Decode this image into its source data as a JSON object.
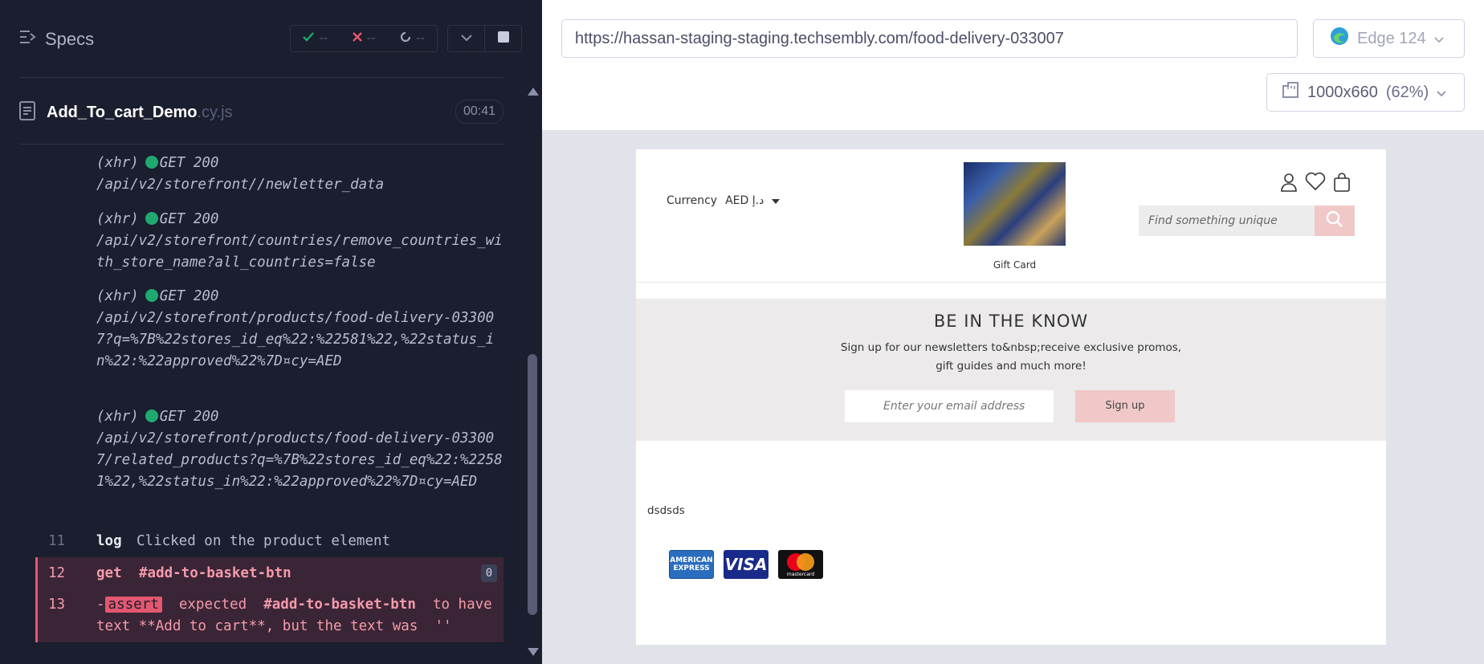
{
  "reporter": {
    "specs_label": "Specs",
    "stats": {
      "passed": "--",
      "failed": "--",
      "pending": "--"
    },
    "spec": {
      "name": "Add_To_cart_Demo",
      "ext": ".cy.js",
      "time": "00:41"
    },
    "xhr_requests": [
      {
        "type": "(xhr)",
        "status": "GET 200",
        "path": "/api/v2/storefront//newletter_data"
      },
      {
        "type": "(xhr)",
        "status": "GET 200",
        "path": "/api/v2/storefront/countries/remove_countries_with_store_name?all_countries=false"
      },
      {
        "type": "(xhr)",
        "status": "GET 200",
        "path": "/api/v2/storefront/products/food-delivery-033007?q=%7B%22stores_id_eq%22:%22581%22,%22status_in%22:%22approved%22%7D¤cy=AED"
      },
      {
        "type": "(xhr)",
        "status": "GET 200",
        "path": "/api/v2/storefront/products/food-delivery-033007/related_products?q=%7B%22stores_id_eq%22:%22581%22,%22status_in%22:%22approved%22%7D¤cy=AED"
      }
    ],
    "commands": [
      {
        "num": "11",
        "name": "log",
        "message": "Clicked on the product element"
      },
      {
        "num": "12",
        "name": "get",
        "message": "#add-to-basket-btn",
        "count": "0"
      },
      {
        "num": "13",
        "prefix": "-",
        "name": "assert",
        "message_parts": [
          "expected",
          "#add-to-basket-btn",
          "to have",
          "text **Add to cart**, but the text was",
          "''"
        ]
      }
    ]
  },
  "aut": {
    "url": "https://hassan-staging-staging.techsembly.com/food-delivery-033007",
    "browser": "Edge 124",
    "viewport": "1000x660",
    "viewport_pct": "(62%)"
  },
  "site": {
    "currency_label": "Currency",
    "currency_value": "AED د.إ",
    "logo_label": "Gift Card",
    "search_placeholder": "Find something unique",
    "newsletter": {
      "title": "BE IN THE KNOW",
      "text": "Sign up for our newsletters to&nbsp;receive exclusive promos, gift guides and much more!",
      "email_placeholder": "Enter your email address",
      "button": "Sign up"
    },
    "footer_text": "dsdsds",
    "payment_cards": [
      "american-express",
      "visa",
      "mastercard"
    ],
    "card_labels": {
      "amex": "AMERICAN EXPRESS",
      "visa": "VISA",
      "mastercard": "mastercard"
    }
  },
  "colors": {
    "reporter_bg": "#1b1e2e",
    "pass": "#1fa971",
    "fail": "#e45770",
    "accent_pink": "#f0c8c8"
  }
}
